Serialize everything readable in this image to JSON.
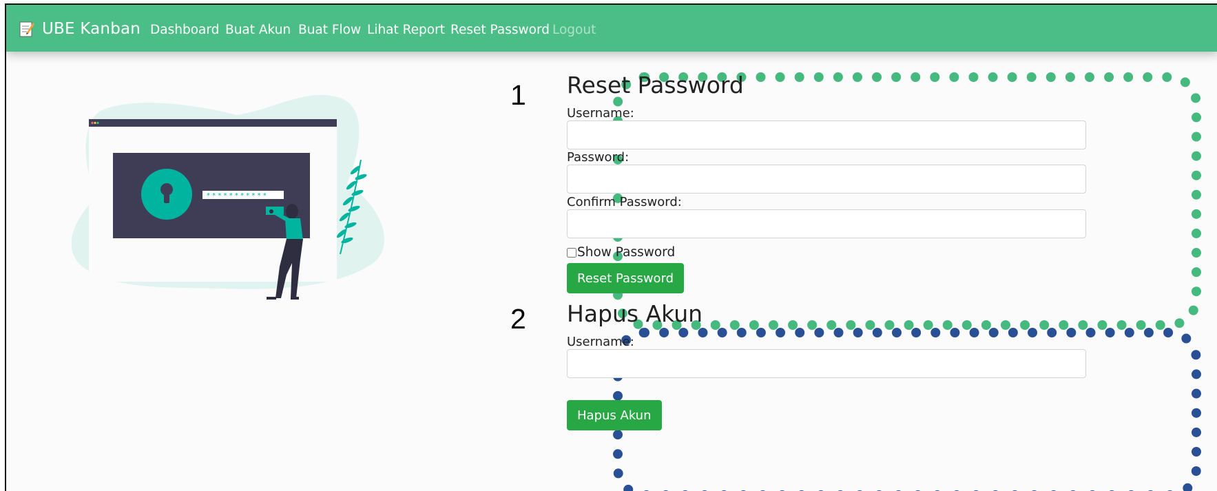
{
  "navbar": {
    "brand": "UBE Kanban",
    "brand_icon": "memo-icon",
    "links": [
      "Dashboard",
      "Buat Akun",
      "Buat Flow",
      "Lihat Report",
      "Reset Password",
      "Logout"
    ],
    "bg_color": "#4bbd86"
  },
  "annotations": {
    "section_1": "1",
    "section_2": "2",
    "section_1_color": "#46b97e",
    "section_2_color": "#294f95"
  },
  "reset_form": {
    "title": "Reset Password",
    "username_label": "Username:",
    "username_value": "",
    "password_label": "Password:",
    "password_value": "",
    "confirm_label": "Confirm Password:",
    "confirm_value": "",
    "show_password_label": "Show Password",
    "show_password_checked": false,
    "submit_label": "Reset Password"
  },
  "delete_form": {
    "title": "Hapus Akun",
    "username_label": "Username:",
    "username_value": "",
    "submit_label": "Hapus Akun"
  },
  "colors": {
    "button": "#28a745",
    "illustration_accent": "#00b4a0",
    "illustration_dark": "#3f3d56"
  }
}
